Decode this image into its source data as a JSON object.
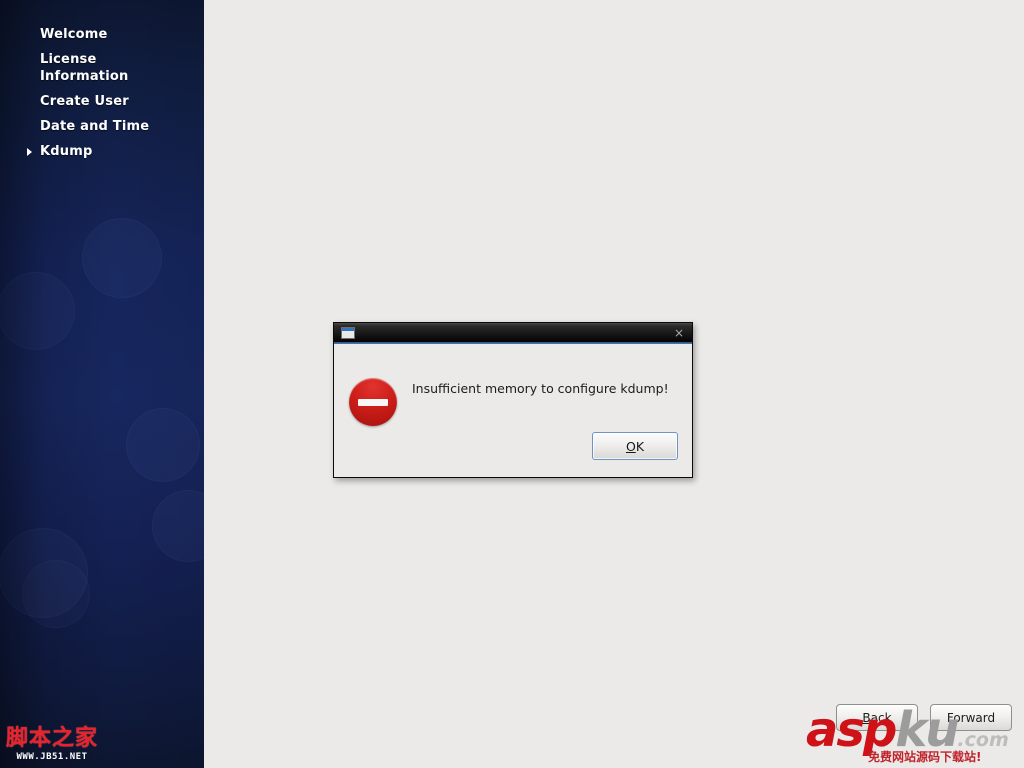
{
  "colors": {
    "sidebar_top": "#0d1732",
    "sidebar_mid": "#17275f",
    "sidebar_bottom": "#0d1630",
    "content_bg": "#ebeae8",
    "error_red": "#cf1f1a",
    "focus_blue": "#6f93c4",
    "watermark_red": "#cf1118",
    "watermark_gray": "#9c9c9c"
  },
  "sidebar": {
    "items": [
      {
        "label": "Welcome",
        "marker": false,
        "selected": false
      },
      {
        "label": "License Information",
        "marker": false,
        "selected": false
      },
      {
        "label": "Create User",
        "marker": false,
        "selected": false
      },
      {
        "label": "Date and Time",
        "marker": false,
        "selected": false
      },
      {
        "label": "Kdump",
        "marker": true,
        "selected": true
      }
    ]
  },
  "wizard_buttons": {
    "back": {
      "label": "Back",
      "mnemonic": "B",
      "before": "",
      "after": "ack"
    },
    "forward": {
      "label": "Forward",
      "mnemonic": "",
      "before": "Forward",
      "after": ""
    }
  },
  "dialog": {
    "title": "",
    "window_icon": "window-icon",
    "close_icon": "×",
    "icon": "error-icon",
    "message": "Insufficient memory to configure kdump!",
    "ok_button": {
      "label": "OK",
      "mnemonic": "O",
      "rest": "K"
    }
  },
  "watermarks": {
    "left": {
      "main": "脚本之家",
      "sub": "WWW.JB51.NET"
    },
    "right": {
      "asp": "asp",
      "ku": "ku",
      "com": ".com",
      "sub": "免费网站源码下载站!"
    }
  }
}
